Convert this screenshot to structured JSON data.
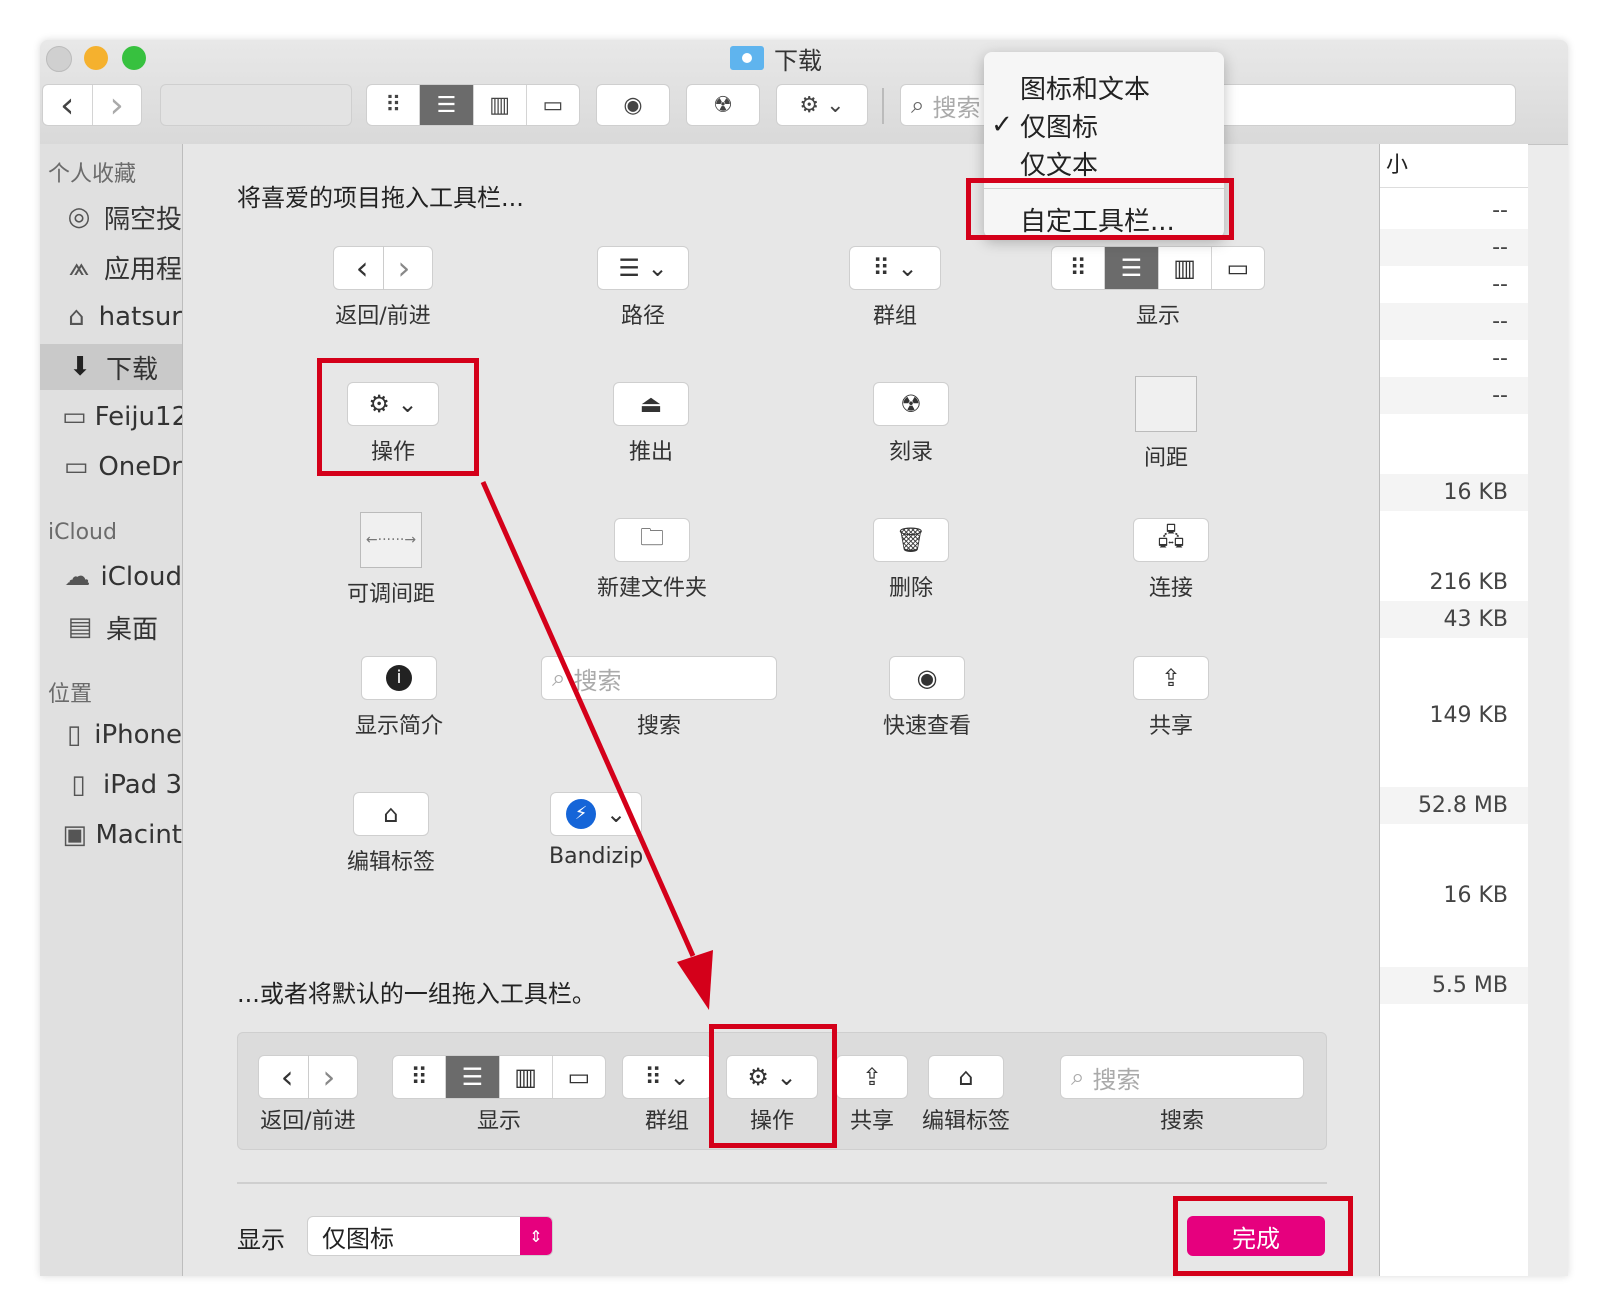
{
  "window": {
    "title": "下载",
    "nav": {
      "back": "‹",
      "forward": "›"
    },
    "search_placeholder": "搜索"
  },
  "sidebar": {
    "sections": [
      {
        "title": "个人收藏",
        "items": [
          {
            "label": "隔空投",
            "icon": "airdrop-icon"
          },
          {
            "label": "应用程",
            "icon": "applications-icon"
          },
          {
            "label": "hatsur",
            "icon": "home-icon"
          },
          {
            "label": "下载",
            "icon": "download-icon",
            "selected": true
          },
          {
            "label": "Feiju12",
            "icon": "folder-icon"
          },
          {
            "label": "OneDr",
            "icon": "folder-icon"
          }
        ]
      },
      {
        "title": "iCloud",
        "items": [
          {
            "label": "iCloud",
            "icon": "cloud-icon"
          },
          {
            "label": "桌面",
            "icon": "desktop-icon"
          }
        ]
      },
      {
        "title": "位置",
        "items": [
          {
            "label": "iPhone",
            "icon": "iphone-icon"
          },
          {
            "label": "iPad 3",
            "icon": "ipad-icon"
          },
          {
            "label": "Macint",
            "icon": "disk-icon"
          }
        ]
      }
    ]
  },
  "file_list": {
    "column_header": "小",
    "sizes": [
      "--",
      "--",
      "--",
      "--",
      "--",
      "--",
      "16 KB",
      "216 KB",
      "43 KB",
      "149 KB",
      "52.8 MB",
      "16 KB",
      "5.5 MB"
    ]
  },
  "dropdown_menu": {
    "items": [
      "图标和文本",
      "仅图标",
      "仅文本",
      "自定工具栏..."
    ],
    "checked": "✓"
  },
  "customize_sheet": {
    "heading": "将喜爱的项目拖入工具栏...",
    "items": {
      "back_forward": "返回/前进",
      "path": "路径",
      "group": "群组",
      "view": "显示",
      "action": "操作",
      "eject": "推出",
      "burn": "刻录",
      "space": "间距",
      "flexible_space": "可调间距",
      "new_folder": "新建文件夹",
      "delete": "删除",
      "connect": "连接",
      "get_info": "显示简介",
      "search": "搜索",
      "quick_look": "快速查看",
      "share": "共享",
      "edit_tags": "编辑标签",
      "bandizip": "Bandizip"
    },
    "search_placeholder": "搜索",
    "default_heading": "...或者将默认的一组拖入工具栏。",
    "default_set": {
      "back_forward": "返回/前进",
      "view": "显示",
      "group": "群组",
      "action": "操作",
      "share": "共享",
      "edit_tags": "编辑标签",
      "search": "搜索",
      "search_placeholder": "搜索"
    },
    "show_label": "显示",
    "show_value": "仅图标",
    "done_button": "完成"
  }
}
